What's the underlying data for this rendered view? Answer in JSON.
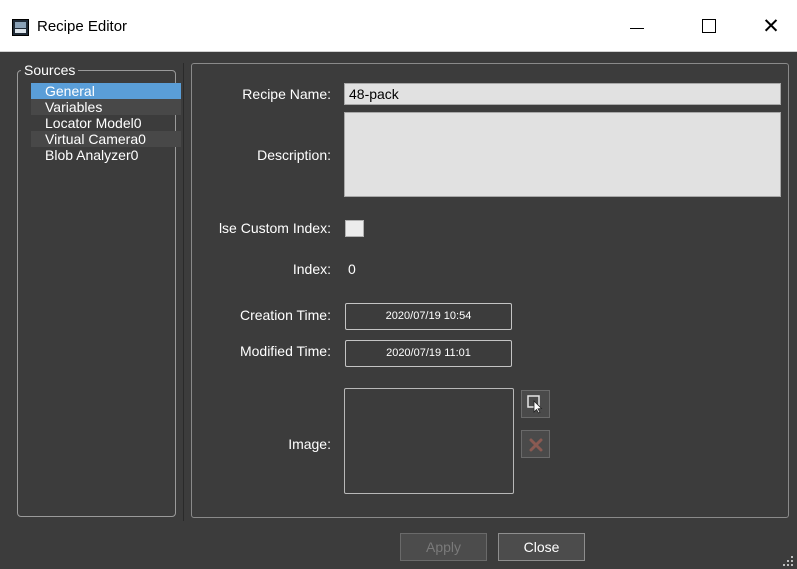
{
  "window": {
    "title": "Recipe Editor",
    "minimize_icon": "minimize-icon",
    "maximize_icon": "maximize-icon",
    "close_glyph": "✕"
  },
  "sources": {
    "legend": "Sources",
    "items": [
      {
        "label": "General",
        "selected": true
      },
      {
        "label": "Variables",
        "selected": false
      },
      {
        "label": "Locator Model0",
        "selected": false
      },
      {
        "label": "Virtual Camera0",
        "selected": false
      },
      {
        "label": "Blob Analyzer0",
        "selected": false
      }
    ]
  },
  "general": {
    "recipe_name_label": "Recipe Name:",
    "recipe_name_value": "48-pack",
    "description_label": "Description:",
    "description_value": "",
    "use_custom_index_label": "lse Custom Index:",
    "use_custom_index_checked": false,
    "index_label": "Index:",
    "index_value": "0",
    "creation_time_label": "Creation Time:",
    "creation_time_value": "2020/07/19 10:54",
    "modified_time_label": "Modified Time:",
    "modified_time_value": "2020/07/19 11:01",
    "image_label": "Image:",
    "select_image_icon": "select-image-icon",
    "delete_image_icon": "delete-image-icon"
  },
  "footer": {
    "apply_label": "Apply",
    "apply_enabled": false,
    "close_label": "Close"
  },
  "colors": {
    "background": "#3c3c3c",
    "selection": "#5a9ed8",
    "field": "#e1e1e1"
  }
}
